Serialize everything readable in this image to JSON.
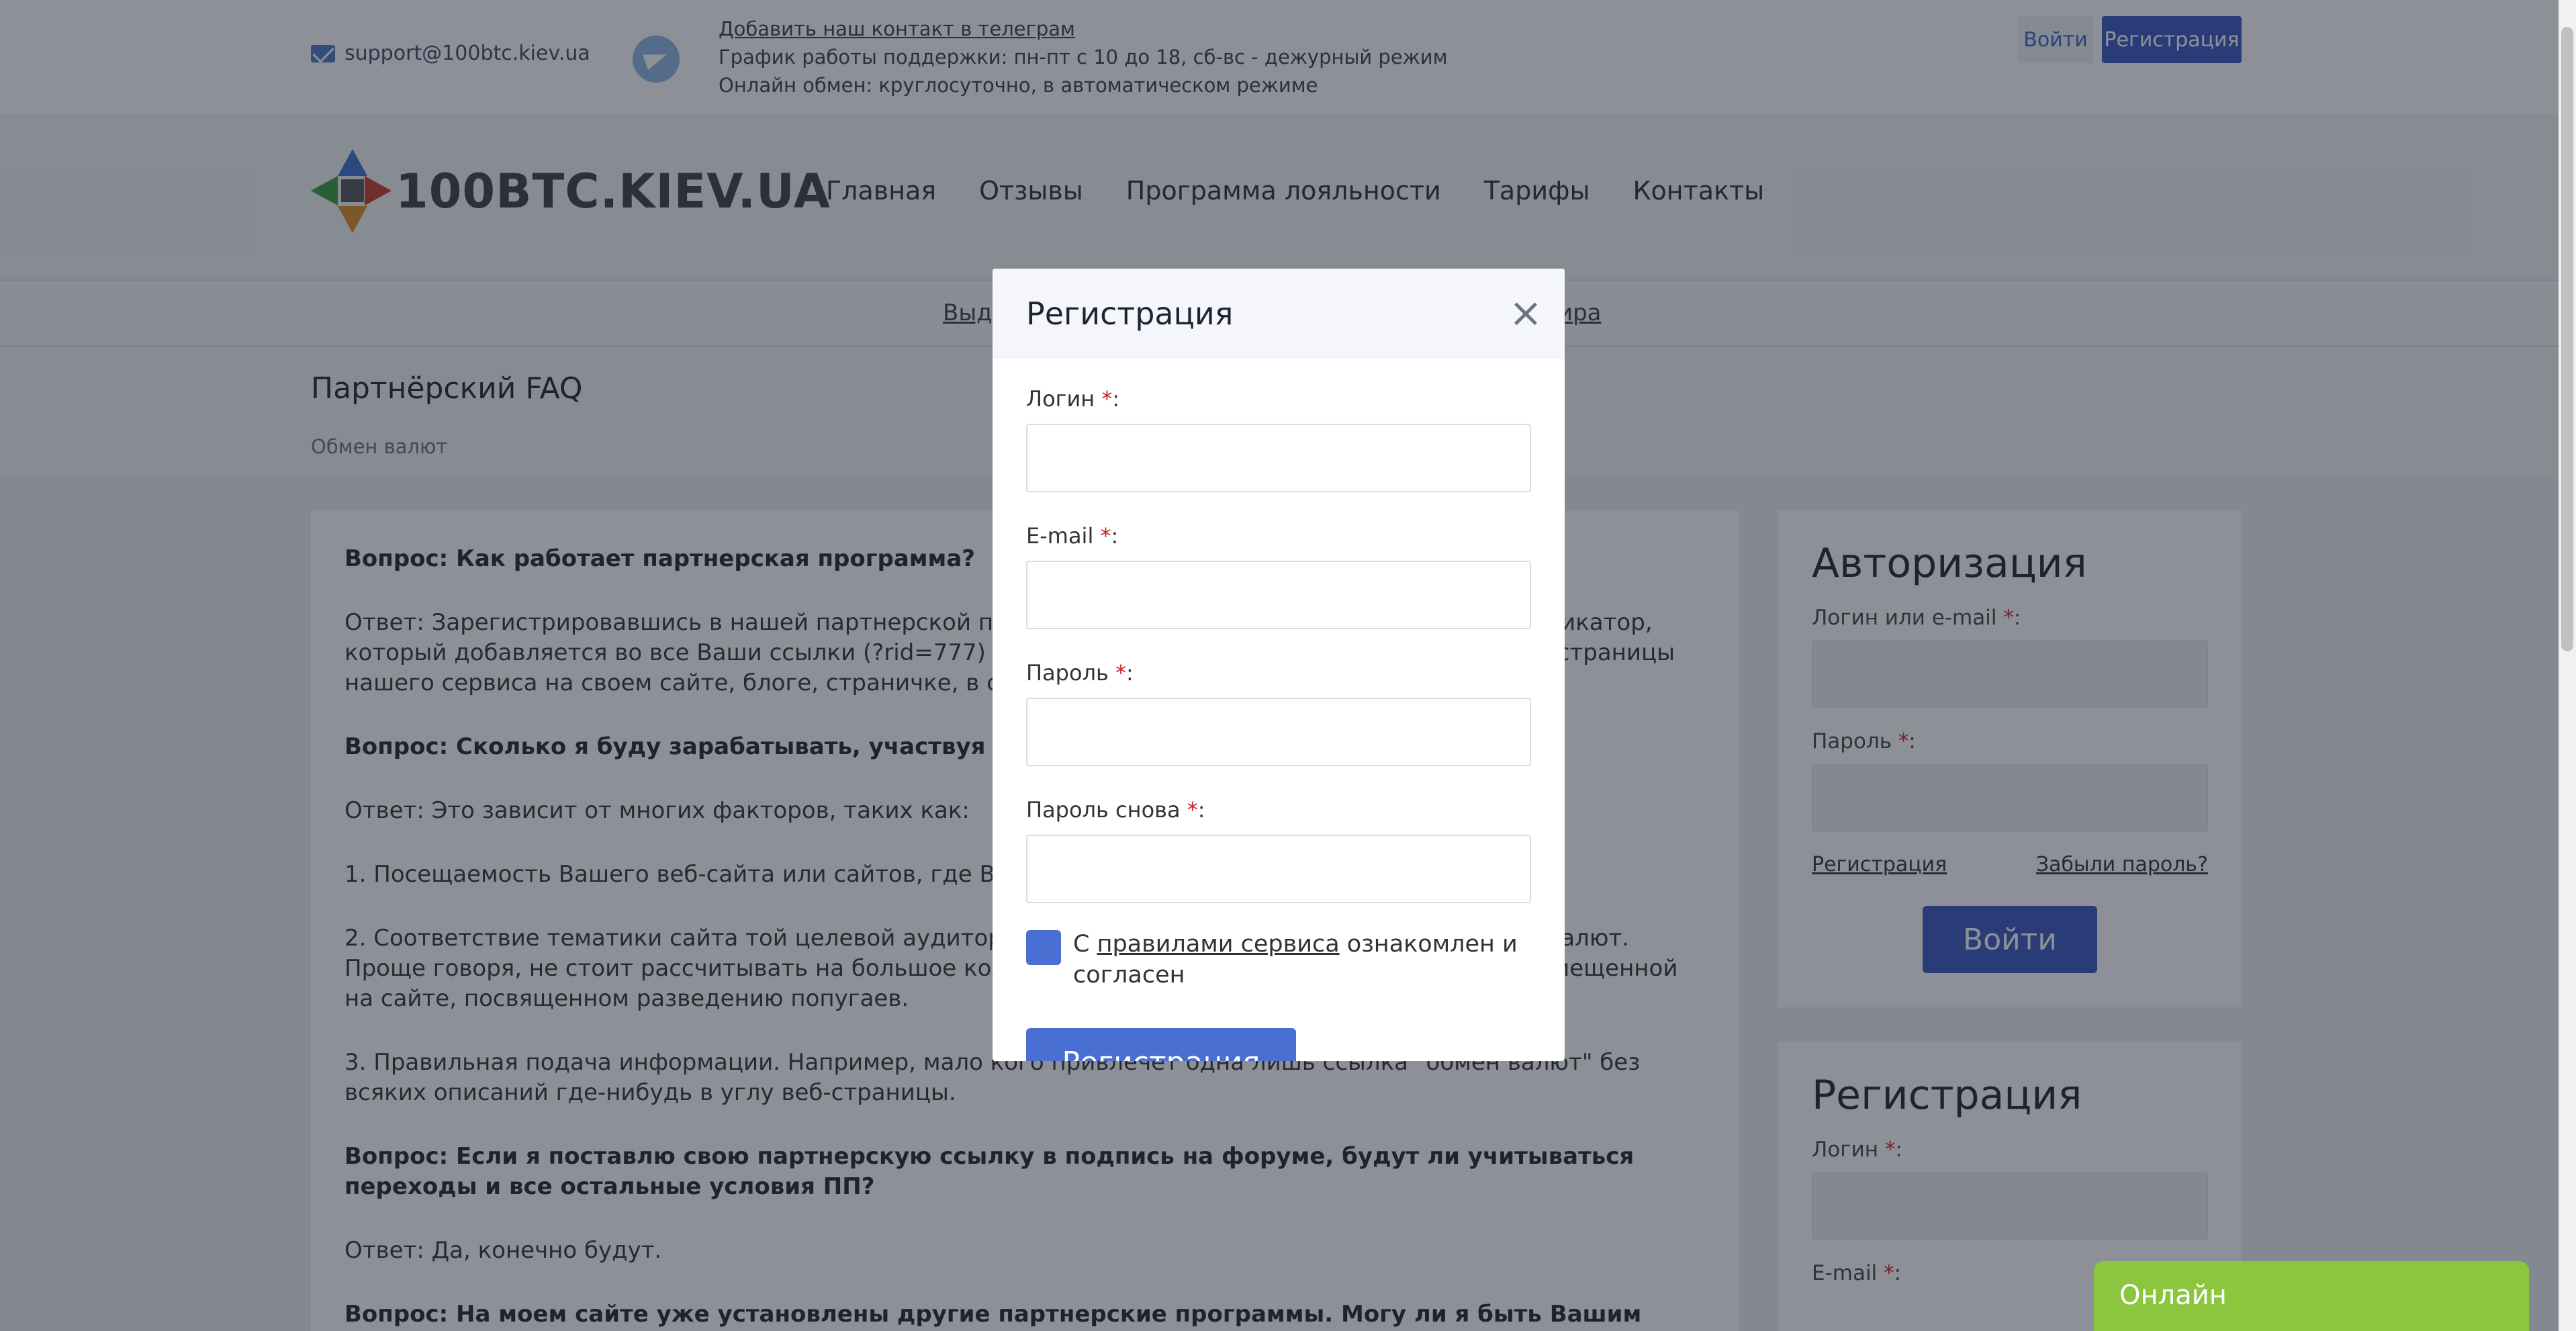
{
  "topbar": {
    "email": "support@100btc.kiev.ua",
    "telegram_link": "Добавить наш контакт в телеграм",
    "schedule": "График работы поддержки: пн-пт с 10 до 18, сб-вс - дежурный режим",
    "online": "Онлайн обмен: круглосуточно, в автоматическом режиме",
    "login_label": "Войти",
    "register_label": "Регистрация"
  },
  "logo": {
    "text": "100BTC.KIEV.UA"
  },
  "nav": {
    "items": [
      "Главная",
      "Отзывы",
      "Программа лояльности",
      "Тарифы",
      "Контакты"
    ]
  },
  "subnav": {
    "left": "Выд",
    "right": "ира"
  },
  "page": {
    "title": "Партнёрский FAQ",
    "breadcrumb": "Обмен валют"
  },
  "faq": {
    "items": [
      {
        "kind": "q",
        "text": "Вопрос: Как работает партнерская программа?"
      },
      {
        "kind": "a",
        "text": "Ответ: Зарегистрировавшись в нашей партнерской программе, Вы получаете уникальный идентификатор, который добавляется во все Ваши ссылки (?rid=777) и HTML-код. Вы можете размещать ссылки на страницы нашего сервиса  на своем сайте, блоге, страничке, в сообществах."
      },
      {
        "kind": "q",
        "text": "Вопрос: Сколько я буду зарабатывать, участвуя в Вашей партнерской программе?"
      },
      {
        "kind": "a",
        "text": "Ответ: Это зависит от многих факторов, таких как:"
      },
      {
        "kind": "a",
        "text": "1. Посещаемость Вашего веб-сайта или сайтов, где Вы размещаете партнерскую ссылку."
      },
      {
        "kind": "a",
        "text": "2. Соответствие тематики сайта той целевой аудитории, которая будет заинтересована в обмене валют. Проще говоря, не стоит рассчитывать на большое количество переходов и обменов по ссылке, размещенной на сайте, посвященном разведению попугаев."
      },
      {
        "kind": "a",
        "text": "3. Правильная подача информации. Например, мало кого привлечет одна лишь ссылка \"обмен валют\" без всяких описаний где-нибудь в углу веб-страницы."
      },
      {
        "kind": "q",
        "text": "Вопрос: Если я поставлю свою партнерскую ссылку в подпись на форуме, будут ли учитываться переходы и все остальные условия ПП?"
      },
      {
        "kind": "a",
        "text": "Ответ: Да, конечно будут."
      },
      {
        "kind": "q",
        "text": "Вопрос: На моем сайте уже установлены другие партнерские программы. Могу ли я быть Вашим партнером?"
      }
    ]
  },
  "sidebar": {
    "auth": {
      "title": "Авторизация",
      "login_label": "Логин или e-mail",
      "password_label": "Пароль",
      "register_link": "Регистрация",
      "forgot_link": "Забыли пароль?",
      "submit": "Войти"
    },
    "register": {
      "title": "Регистрация",
      "login_label": "Логин",
      "email_label": "E-mail"
    }
  },
  "required_mark": "*",
  "chat": {
    "label": "Онлайн"
  },
  "modal": {
    "title": "Регистрация",
    "close": "×",
    "login_label": "Логин",
    "email_label": "E-mail",
    "password_label": "Пароль",
    "password2_label": "Пароль снова",
    "agree_prefix": "С ",
    "agree_link": "правилами сервиса",
    "agree_suffix": " ознакомлен и согласен",
    "submit": "Регистрация"
  },
  "colors": {
    "primary": "#3656c2",
    "modal_button": "#4a6fd3",
    "chat": "#8cc63f",
    "required": "#c62828"
  }
}
